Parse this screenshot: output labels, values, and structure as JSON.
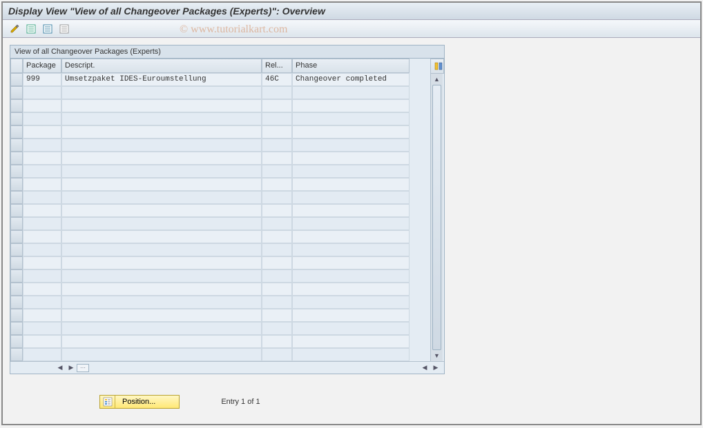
{
  "window_title": "Display View \"View of all Changeover Packages (Experts)\": Overview",
  "panel_title": "View of all Changeover Packages (Experts)",
  "columns": {
    "package": "Package",
    "descript": "Descript.",
    "rel": "Rel...",
    "phase": "Phase"
  },
  "rows": [
    {
      "package": "999",
      "descript": "Umsetzpaket IDES-Euroumstellung",
      "rel": "46C",
      "phase": "Changeover completed"
    }
  ],
  "position_btn": "Position...",
  "entry_text": "Entry 1 of 1",
  "watermark": "© www.tutorialkart.com",
  "toolbar_icons": [
    "edit-icon",
    "checklist-green-icon",
    "checklist-blue-icon",
    "checklist-gray-icon"
  ]
}
